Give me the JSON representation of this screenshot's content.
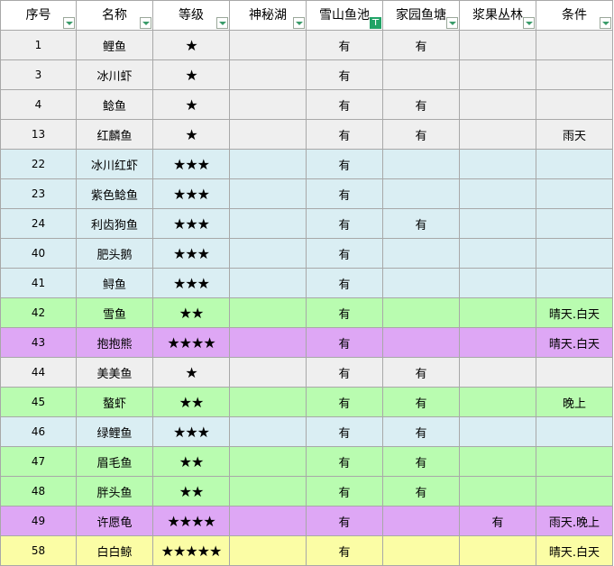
{
  "columns": [
    {
      "label": "序号",
      "filter_active": false
    },
    {
      "label": "名称",
      "filter_active": false
    },
    {
      "label": "等级",
      "filter_active": false
    },
    {
      "label": "神秘湖",
      "filter_active": false
    },
    {
      "label": "雪山鱼池",
      "filter_active": true
    },
    {
      "label": "家园鱼塘",
      "filter_active": false
    },
    {
      "label": "浆果丛林",
      "filter_active": false
    },
    {
      "label": "条件",
      "filter_active": false
    }
  ],
  "row_colors": {
    "gray": "#efefef",
    "blue": "#daeef3",
    "green": "#b9fcb0",
    "purple": "#dea7f5",
    "yellow": "#fbfda5"
  },
  "rows": [
    {
      "num": "1",
      "name": "鲤鱼",
      "stars": "★",
      "mystic_lake": "",
      "snow_pond": "有",
      "home_pond": "有",
      "berry_forest": "",
      "condition": "",
      "color": "gray"
    },
    {
      "num": "3",
      "name": "冰川虾",
      "stars": "★",
      "mystic_lake": "",
      "snow_pond": "有",
      "home_pond": "",
      "berry_forest": "",
      "condition": "",
      "color": "gray"
    },
    {
      "num": "4",
      "name": "鲶鱼",
      "stars": "★",
      "mystic_lake": "",
      "snow_pond": "有",
      "home_pond": "有",
      "berry_forest": "",
      "condition": "",
      "color": "gray"
    },
    {
      "num": "13",
      "name": "红麟鱼",
      "stars": "★",
      "mystic_lake": "",
      "snow_pond": "有",
      "home_pond": "有",
      "berry_forest": "",
      "condition": "雨天",
      "color": "gray"
    },
    {
      "num": "22",
      "name": "冰川红虾",
      "stars": "★★★",
      "mystic_lake": "",
      "snow_pond": "有",
      "home_pond": "",
      "berry_forest": "",
      "condition": "",
      "color": "blue"
    },
    {
      "num": "23",
      "name": "紫色鲶鱼",
      "stars": "★★★",
      "mystic_lake": "",
      "snow_pond": "有",
      "home_pond": "",
      "berry_forest": "",
      "condition": "",
      "color": "blue"
    },
    {
      "num": "24",
      "name": "利齿狗鱼",
      "stars": "★★★",
      "mystic_lake": "",
      "snow_pond": "有",
      "home_pond": "有",
      "berry_forest": "",
      "condition": "",
      "color": "blue"
    },
    {
      "num": "40",
      "name": "肥头鹅",
      "stars": "★★★",
      "mystic_lake": "",
      "snow_pond": "有",
      "home_pond": "",
      "berry_forest": "",
      "condition": "",
      "color": "blue"
    },
    {
      "num": "41",
      "name": "鲟鱼",
      "stars": "★★★",
      "mystic_lake": "",
      "snow_pond": "有",
      "home_pond": "",
      "berry_forest": "",
      "condition": "",
      "color": "blue"
    },
    {
      "num": "42",
      "name": "雪鱼",
      "stars": "★★",
      "mystic_lake": "",
      "snow_pond": "有",
      "home_pond": "",
      "berry_forest": "",
      "condition": "晴天.白天",
      "color": "green"
    },
    {
      "num": "43",
      "name": "抱抱熊",
      "stars": "★★★★",
      "mystic_lake": "",
      "snow_pond": "有",
      "home_pond": "",
      "berry_forest": "",
      "condition": "晴天.白天",
      "color": "purple"
    },
    {
      "num": "44",
      "name": "美美鱼",
      "stars": "★",
      "mystic_lake": "",
      "snow_pond": "有",
      "home_pond": "有",
      "berry_forest": "",
      "condition": "",
      "color": "gray"
    },
    {
      "num": "45",
      "name": "螯虾",
      "stars": "★★",
      "mystic_lake": "",
      "snow_pond": "有",
      "home_pond": "有",
      "berry_forest": "",
      "condition": "晚上",
      "color": "green"
    },
    {
      "num": "46",
      "name": "绿鲤鱼",
      "stars": "★★★",
      "mystic_lake": "",
      "snow_pond": "有",
      "home_pond": "有",
      "berry_forest": "",
      "condition": "",
      "color": "blue"
    },
    {
      "num": "47",
      "name": "眉毛鱼",
      "stars": "★★",
      "mystic_lake": "",
      "snow_pond": "有",
      "home_pond": "有",
      "berry_forest": "",
      "condition": "",
      "color": "green"
    },
    {
      "num": "48",
      "name": "胖头鱼",
      "stars": "★★",
      "mystic_lake": "",
      "snow_pond": "有",
      "home_pond": "有",
      "berry_forest": "",
      "condition": "",
      "color": "green"
    },
    {
      "num": "49",
      "name": "许愿龟",
      "stars": "★★★★",
      "mystic_lake": "",
      "snow_pond": "有",
      "home_pond": "",
      "berry_forest": "有",
      "condition": "雨天.晚上",
      "color": "purple"
    },
    {
      "num": "58",
      "name": "白白鲸",
      "stars": "★★★★★",
      "mystic_lake": "",
      "snow_pond": "有",
      "home_pond": "",
      "berry_forest": "",
      "condition": "晴天.白天",
      "color": "yellow"
    }
  ]
}
